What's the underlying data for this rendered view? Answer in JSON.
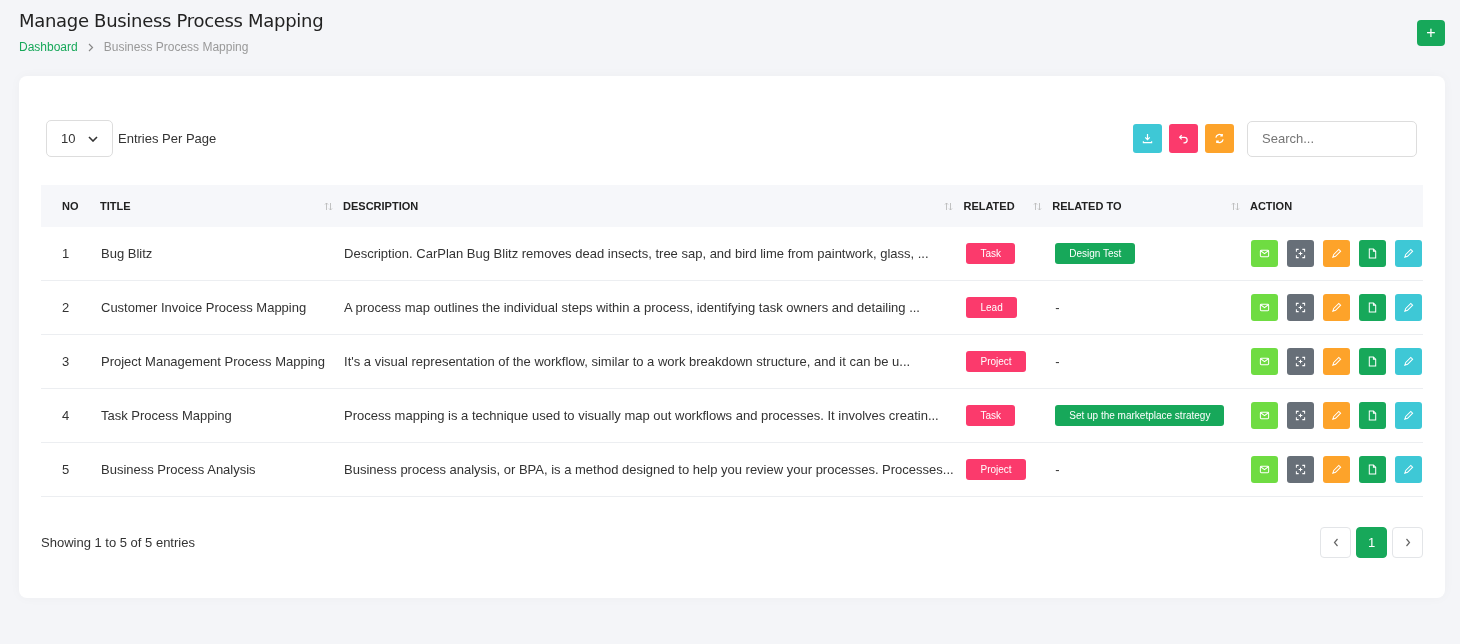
{
  "page": {
    "title": "Manage Business Process Mapping",
    "breadcrumb": [
      {
        "label": "Dashboard",
        "link": true
      },
      {
        "label": "Business Process Mapping",
        "link": false
      }
    ],
    "add_button": "+"
  },
  "toolbar": {
    "page_size": "10",
    "page_size_label": "Entries Per Page",
    "search": {
      "placeholder": "Search..."
    }
  },
  "table": {
    "columns": [
      {
        "label": "NO",
        "sortable": false
      },
      {
        "label": "TITLE",
        "sortable": true
      },
      {
        "label": "DESCRIPTION",
        "sortable": true
      },
      {
        "label": "RELATED",
        "sortable": true
      },
      {
        "label": "RELATED TO",
        "sortable": true
      },
      {
        "label": "ACTION",
        "sortable": false
      }
    ],
    "rows": [
      {
        "no": "1",
        "title": "Bug Blitz",
        "description": "Description. CarPlan Bug Blitz removes dead insects, tree sap, and bird lime from paintwork, glass, ...",
        "related": "Task",
        "related_to": {
          "kind": "badge",
          "text": "Design Test"
        }
      },
      {
        "no": "2",
        "title": "Customer Invoice Process Mapping",
        "description": "A process map outlines the individual steps within a process, identifying task owners and detailing ...",
        "related": "Lead",
        "related_to": {
          "kind": "text",
          "text": "-"
        }
      },
      {
        "no": "3",
        "title": "Project Management Process Mapping",
        "description": "It's a visual representation of the workflow, similar to a work breakdown structure, and it can be u...",
        "related": "Project",
        "related_to": {
          "kind": "text",
          "text": "-"
        }
      },
      {
        "no": "4",
        "title": "Task Process Mapping",
        "description": "Process mapping is a technique used to visually map out workflows and processes. It involves creatin...",
        "related": "Task",
        "related_to": {
          "kind": "badge",
          "text": "Set up the marketplace strategy"
        }
      },
      {
        "no": "5",
        "title": "Business Process Analysis",
        "description": "Business process analysis, or BPA, is a method designed to help you review your processes. Processes...",
        "related": "Project",
        "related_to": {
          "kind": "text",
          "text": "-"
        }
      }
    ]
  },
  "footer": {
    "summary": "Showing 1 to 5 of 5 entries",
    "pages": [
      {
        "label": "1",
        "selected": true
      }
    ]
  }
}
